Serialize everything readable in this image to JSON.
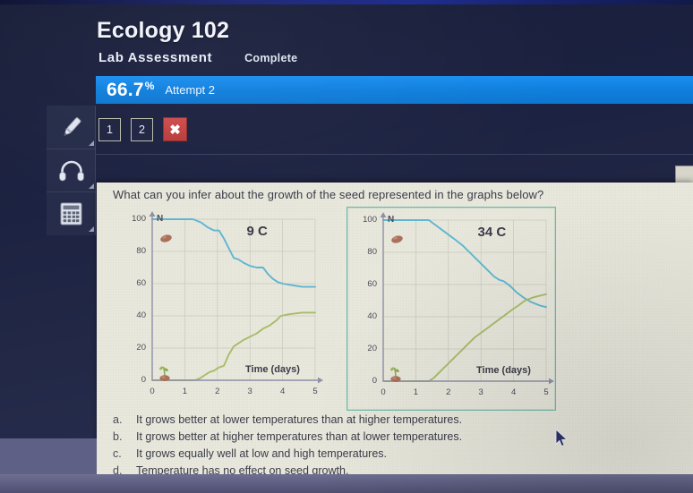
{
  "header": {
    "course_title": "Ecology 102",
    "assessment_name": "Lab Assessment",
    "status": "Complete",
    "score_percent": "66.7",
    "percent_symbol": "%",
    "attempt": "Attempt 2",
    "accent_color": "#1184e8"
  },
  "tools": [
    {
      "name": "highlighter-tool",
      "icon": "pencil-icon"
    },
    {
      "name": "audio-tool",
      "icon": "headphones-icon"
    },
    {
      "name": "calculator-tool",
      "icon": "calculator-icon"
    }
  ],
  "question_nav": {
    "buttons": [
      "1",
      "2"
    ],
    "close_label": "✖"
  },
  "question": {
    "prompt": "What can you infer about the growth of the seed represented in the graphs below?",
    "options": [
      {
        "key": "a.",
        "text": "It grows better at lower temperatures than at higher temperatures."
      },
      {
        "key": "b.",
        "text": "It grows better at higher temperatures than at lower temperatures."
      },
      {
        "key": "c.",
        "text": "It grows equally well at low and high temperatures."
      },
      {
        "key": "d.",
        "text": "Temperature has no effect on seed growth."
      }
    ]
  },
  "chart_data": [
    {
      "type": "line",
      "title": "9 C",
      "xlabel": "Time (days)",
      "ylabel": "N",
      "xlim": [
        0,
        5
      ],
      "ylim": [
        0,
        100
      ],
      "xticks": [
        0,
        1,
        2,
        3,
        4,
        5
      ],
      "yticks": [
        0,
        20,
        40,
        60,
        80,
        100
      ],
      "grid": true,
      "legend": "none",
      "series": [
        {
          "name": "ungerminated-seeds",
          "color": "#5fb6d2",
          "x": [
            0,
            0.5,
            1.0,
            1.25,
            1.5,
            1.7,
            1.9,
            2.05,
            2.2,
            2.35,
            2.5,
            2.65,
            2.8,
            3.0,
            3.2,
            3.4,
            3.55,
            3.7,
            3.85,
            4.0,
            4.3,
            4.6,
            5.0
          ],
          "values": [
            100,
            100,
            100,
            100,
            98,
            95,
            93,
            93,
            88,
            82,
            76,
            75,
            73,
            71,
            70,
            70,
            66,
            63,
            61,
            60,
            59,
            58,
            58
          ]
        },
        {
          "name": "germinated-seedlings",
          "color": "#a8bc6a",
          "x": [
            0,
            0.5,
            1.0,
            1.3,
            1.45,
            1.6,
            1.75,
            1.9,
            2.05,
            2.2,
            2.35,
            2.5,
            2.65,
            2.8,
            3.0,
            3.2,
            3.4,
            3.6,
            3.8,
            3.95,
            4.2,
            4.6,
            5.0
          ],
          "values": [
            0,
            0,
            0,
            0,
            1,
            3,
            5,
            6,
            8,
            9,
            16,
            21,
            23,
            25,
            27,
            29,
            32,
            34,
            37,
            40,
            41,
            42,
            42
          ]
        }
      ]
    },
    {
      "type": "line",
      "title": "34 C",
      "xlabel": "Time (days)",
      "ylabel": "N",
      "xlim": [
        0,
        5
      ],
      "ylim": [
        0,
        100
      ],
      "xticks": [
        0,
        1,
        2,
        3,
        4,
        5
      ],
      "yticks": [
        0,
        20,
        40,
        60,
        80,
        100
      ],
      "grid": true,
      "legend": "none",
      "series": [
        {
          "name": "ungerminated-seeds",
          "color": "#5fb6d2",
          "x": [
            0,
            0.5,
            1.0,
            1.4,
            1.6,
            1.8,
            2.0,
            2.2,
            2.45,
            2.65,
            2.85,
            3.0,
            3.2,
            3.4,
            3.55,
            3.7,
            3.9,
            4.1,
            4.3,
            4.55,
            4.8,
            5.0
          ],
          "values": [
            100,
            100,
            100,
            100,
            97,
            94,
            91,
            88,
            84,
            80,
            76,
            73,
            69,
            65,
            63,
            62,
            59,
            55,
            52,
            49,
            47,
            46
          ]
        },
        {
          "name": "germinated-seedlings",
          "color": "#a8bc6a",
          "x": [
            0,
            0.5,
            1.0,
            1.4,
            1.55,
            1.75,
            1.95,
            2.15,
            2.4,
            2.6,
            2.8,
            3.0,
            3.2,
            3.4,
            3.6,
            3.8,
            4.0,
            4.15,
            4.35,
            4.6,
            4.8,
            5.0
          ],
          "values": [
            0,
            0,
            0,
            0,
            2,
            6,
            10,
            14,
            19,
            23,
            27,
            30,
            33,
            36,
            39,
            42,
            45,
            47,
            50,
            52,
            53,
            54
          ]
        }
      ]
    }
  ]
}
